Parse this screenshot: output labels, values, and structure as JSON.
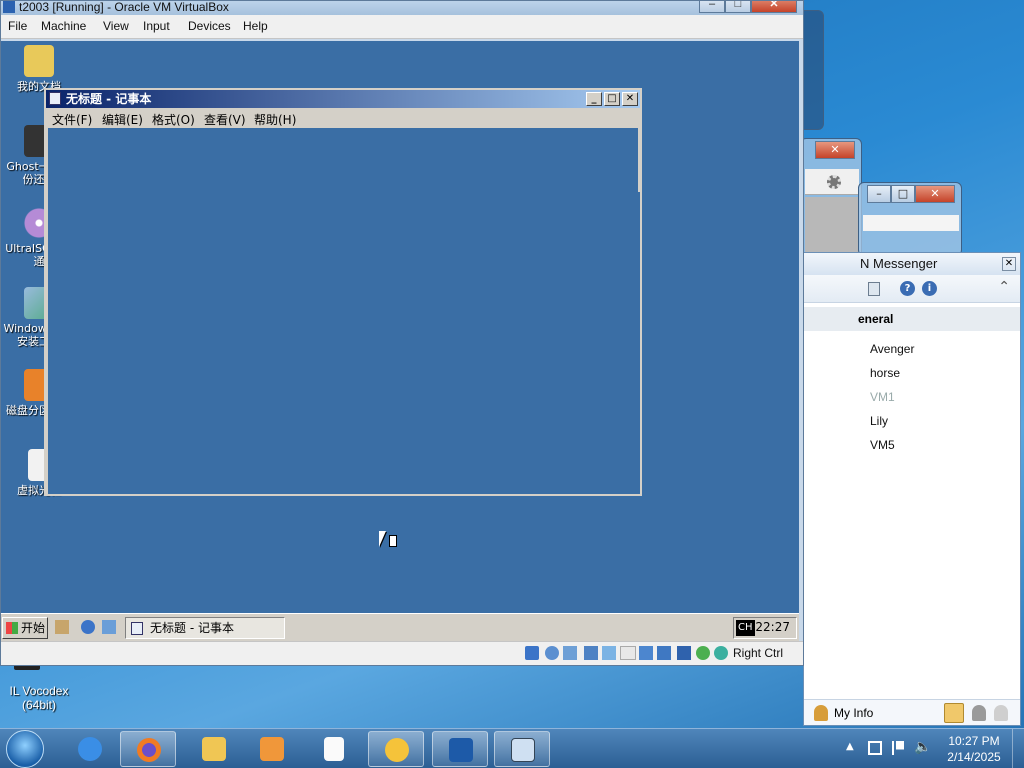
{
  "host_desktop": {
    "icons": [
      {
        "label_line1": "IL Vocodex",
        "label_line2": "(64bit)"
      }
    ]
  },
  "host_windows": {
    "messenger": {
      "title": "N Messenger",
      "group": "eneral",
      "contacts": [
        {
          "name": "Avenger",
          "online": true
        },
        {
          "name": "horse",
          "online": true
        },
        {
          "name": "VM1",
          "online": false
        },
        {
          "name": "Lily",
          "online": true
        },
        {
          "name": "VM5",
          "online": true
        }
      ],
      "my_info": "My Info"
    }
  },
  "vbox": {
    "title": "t2003 [Running] - Oracle VM VirtualBox",
    "menu": [
      "File",
      "Machine",
      "View",
      "Input",
      "Devices",
      "Help"
    ],
    "status_hostkey": "Right Ctrl"
  },
  "guest": {
    "desktop_icons": [
      {
        "line1": "我的文档",
        "line2": ""
      },
      {
        "line1": "Ghost一键备",
        "line2": "份还原"
      },
      {
        "line1": "UltraISO软碟",
        "line2": "通"
      },
      {
        "line1": "Windows快速",
        "line2": "安装工具"
      },
      {
        "line1": "磁盘分区管理",
        "line2": ""
      },
      {
        "line1": "虚拟光驱",
        "line2": ""
      }
    ],
    "notepad": {
      "title": "无标题 - 记事本",
      "menu": [
        "文件(F)",
        "编辑(E)",
        "格式(O)",
        "查看(V)",
        "帮助(H)"
      ]
    },
    "taskbar": {
      "start_label": "开始",
      "task_label": "无标题 - 记事本",
      "ime": "CH",
      "clock": "22:27"
    }
  },
  "host_taskbar": {
    "clock_time": "10:27 PM",
    "clock_date": "2/14/2025"
  },
  "colors": {
    "guest_desktop": "#3a6ea5",
    "xp_title": "#0a246a",
    "host_taskbar": "#2c5f94"
  }
}
